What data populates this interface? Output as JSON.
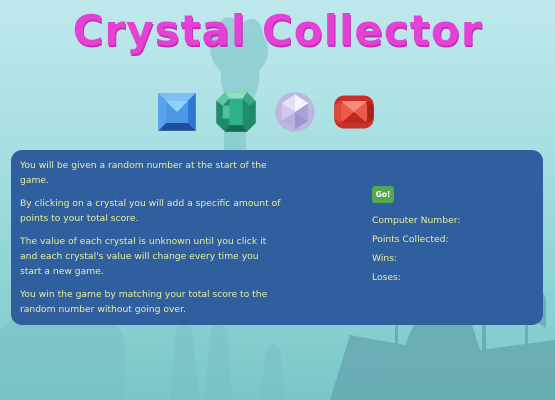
{
  "title": "Crystal Collector",
  "crystals": [
    {
      "name": "blue-crystal",
      "color": "#3c8fe0"
    },
    {
      "name": "green-crystal",
      "color": "#2ea886"
    },
    {
      "name": "white-crystal",
      "color": "#d8d4ef"
    },
    {
      "name": "red-crystal",
      "color": "#e04a3a"
    }
  ],
  "instructions": [
    "You will be given a random number at the start of the game.",
    "By clicking on a crystal you will add a specific amount of points to your total score.",
    "The value of each crystal is unknown until you click it and each crystal's value will change every time you start a new game.",
    "You win the game by matching your total score to the random number without going over."
  ],
  "go_button": "Go!",
  "stats": {
    "computer_number": "Computer Number:",
    "points_collected": "Points Collected:",
    "wins": "Wins:",
    "loses": "Loses:"
  },
  "colors": {
    "title": "#e641d6",
    "panel": "#2f5f9f",
    "text": "#e7ef9c",
    "button": "#53a951"
  }
}
